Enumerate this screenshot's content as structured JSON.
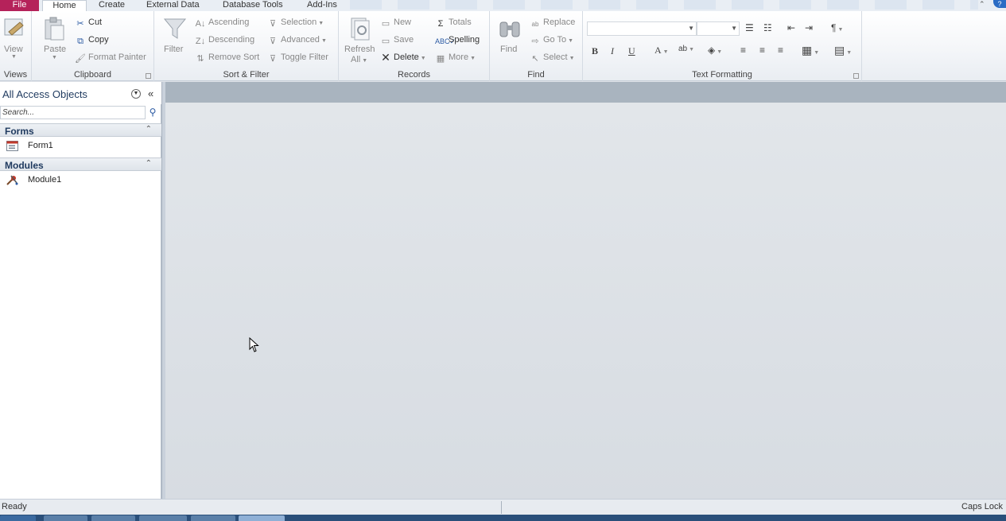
{
  "tabs": {
    "file": "File",
    "home": "Home",
    "create": "Create",
    "external_data": "External Data",
    "database_tools": "Database Tools",
    "add_ins": "Add-Ins"
  },
  "ribbon": {
    "views": {
      "label": "Views",
      "view": "View"
    },
    "clipboard": {
      "label": "Clipboard",
      "paste": "Paste",
      "cut": "Cut",
      "copy": "Copy",
      "format_painter": "Format Painter"
    },
    "sort_filter": {
      "label": "Sort & Filter",
      "filter": "Filter",
      "ascending": "Ascending",
      "descending": "Descending",
      "remove_sort": "Remove Sort",
      "selection": "Selection",
      "advanced": "Advanced",
      "toggle_filter": "Toggle Filter"
    },
    "records": {
      "label": "Records",
      "refresh": "Refresh",
      "refresh_all": "All",
      "new": "New",
      "save": "Save",
      "delete": "Delete",
      "totals": "Totals",
      "spelling": "Spelling",
      "more": "More"
    },
    "find": {
      "label": "Find",
      "find": "Find",
      "replace": "Replace",
      "go_to": "Go To",
      "select": "Select"
    },
    "text_formatting": {
      "label": "Text Formatting",
      "bold": "B",
      "italic": "I",
      "underline": "U",
      "font_color": "A"
    }
  },
  "nav": {
    "title": "All Access Objects",
    "search_placeholder": "Search...",
    "sections": [
      {
        "label": "Forms",
        "items": [
          {
            "label": "Form1"
          }
        ]
      },
      {
        "label": "Modules",
        "items": [
          {
            "label": "Module1"
          }
        ]
      }
    ]
  },
  "status": {
    "left": "Ready",
    "right": "Caps Lock"
  },
  "colors": {
    "file_tab": "#b5225a",
    "accent": "#2b6cc4"
  }
}
